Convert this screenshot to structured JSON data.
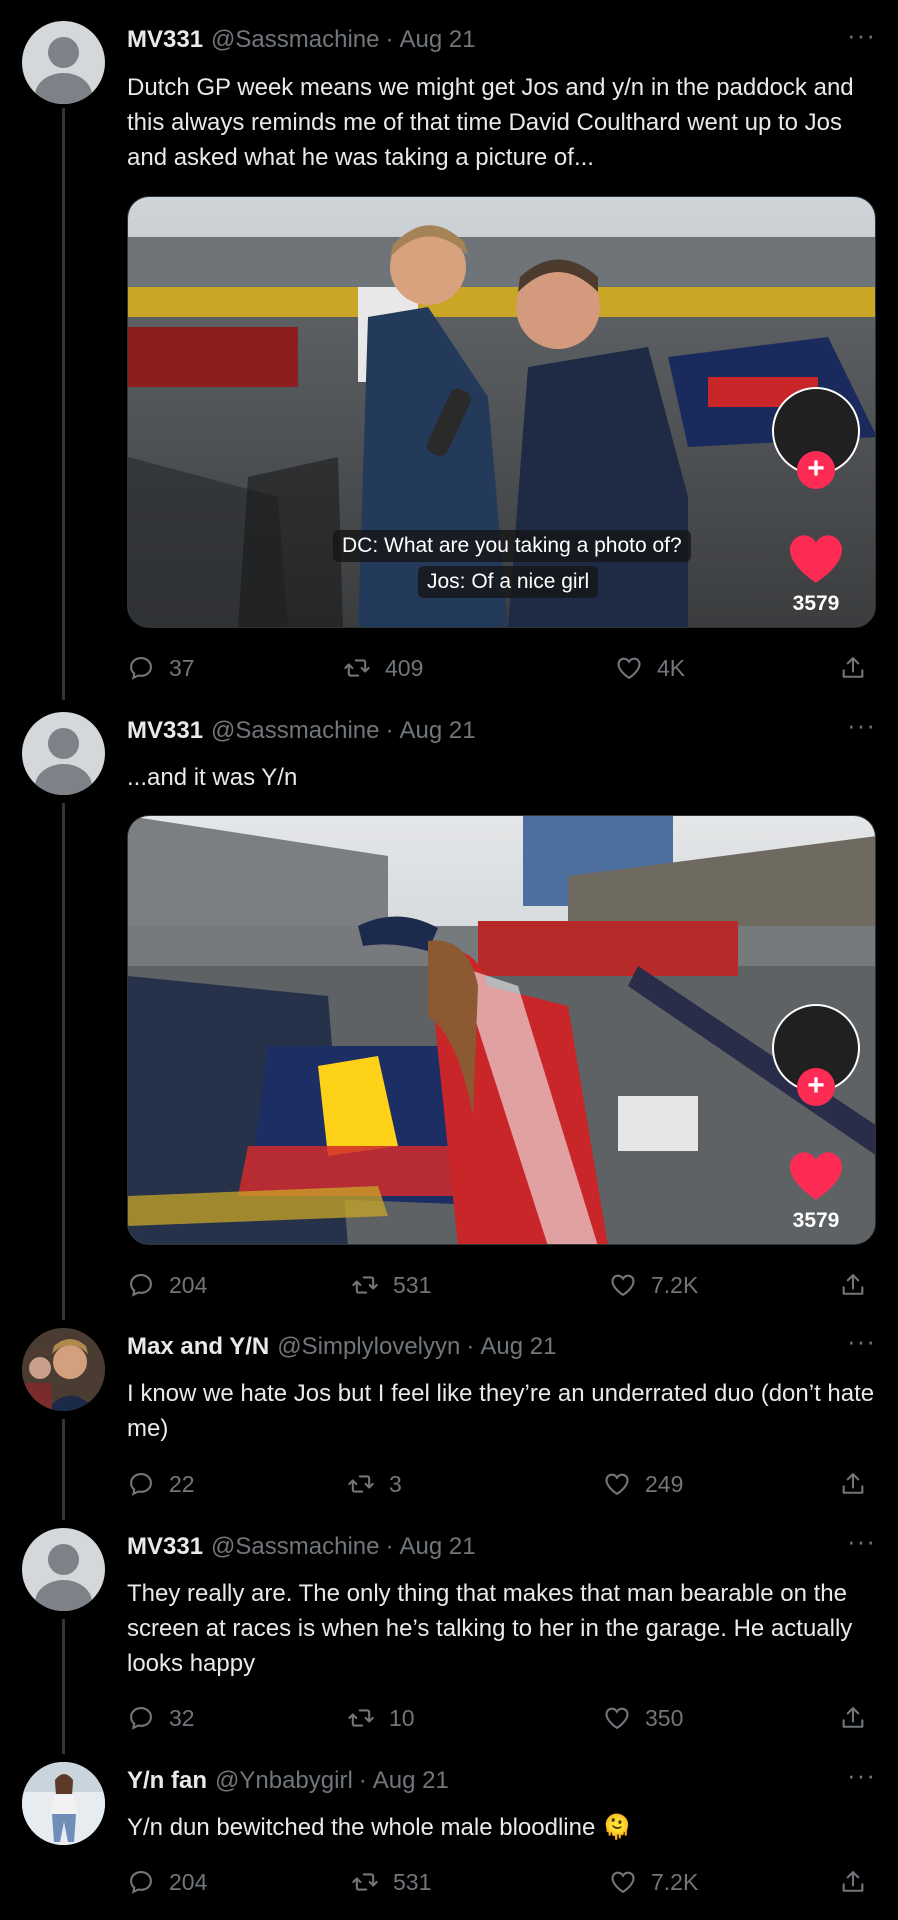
{
  "tweets": [
    {
      "name": "MV331",
      "handle": "@Sassmachine",
      "date": "Aug 21",
      "text": "Dutch GP week means we might get Jos and y/n in the paddock and this always reminds me of that time David Coulthard went up to Jos and asked what he was taking a picture of...",
      "media": {
        "caption_line1": "DC: What are you taking a photo of?",
        "caption_line2": "Jos: Of a nice girl",
        "likes": "3579"
      },
      "replies": "37",
      "retweets": "409",
      "likes": "4K"
    },
    {
      "name": "MV331",
      "handle": "@Sassmachine",
      "date": "Aug 21",
      "text": "...and it was Y/n",
      "media": {
        "likes": "3579"
      },
      "replies": "204",
      "retweets": "531",
      "likes": "7.2K"
    },
    {
      "name": "Max and Y/N",
      "handle": "@Simplylovelyyn",
      "date": "Aug 21",
      "text": "I know we hate Jos but I feel like they’re an underrated duo (don’t hate me)",
      "replies": "22",
      "retweets": "3",
      "likes": "249"
    },
    {
      "name": "MV331",
      "handle": "@Sassmachine",
      "date": "Aug 21",
      "text": "They really are. The only thing that makes that man bearable on the screen at races is when he’s talking to her in the garage. He actually looks happy",
      "replies": "32",
      "retweets": "10",
      "likes": "350"
    },
    {
      "name": "Y/n fan",
      "handle": "@Ynbabygirl",
      "date": "Aug 21",
      "text": "Y/n dun bewitched the whole male bloodline 🫠",
      "replies": "204",
      "retweets": "531",
      "likes": "7.2K"
    }
  ],
  "ui": {
    "separator": "·",
    "more": "···",
    "plus": "+"
  },
  "colors": {
    "background": "#000000",
    "text_primary": "#e7e9ea",
    "text_secondary": "#71767b",
    "thread_line": "#333639",
    "tiktok_red": "#fe2c55"
  }
}
